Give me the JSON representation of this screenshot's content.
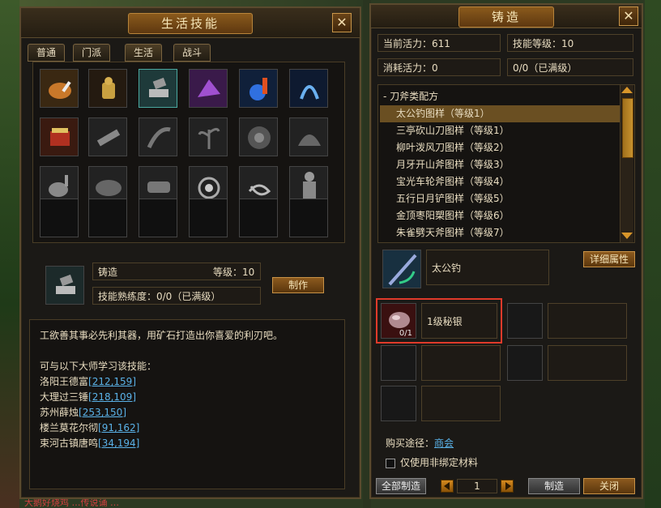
{
  "life_skills": {
    "title": "生活技能",
    "tabs": [
      "普通",
      "门派",
      "生活",
      "战斗"
    ],
    "skill": {
      "name": "铸造",
      "level_label": "等级：10",
      "proficiency": "技能熟练度：0/0（已满级）",
      "make_button": "制作"
    },
    "desc": {
      "intro": "工欲善其事必先利其器，用矿石打造出你喜爱的利刃吧。",
      "masters_header": "可与以下大师学习该技能：",
      "masters": [
        {
          "name": "洛阳王德富",
          "coord": "[212,159]"
        },
        {
          "name": "大理过三锤",
          "coord": "[218,109]"
        },
        {
          "name": "苏州薛烛",
          "coord": "[253,150]"
        },
        {
          "name": "楼兰莫花尔彻",
          "coord": "[91,162]"
        },
        {
          "name": "束河古镇唐鸣",
          "coord": "[34,194]"
        }
      ]
    }
  },
  "forge": {
    "title": "铸造",
    "current_vigor": "当前活力：611",
    "skill_level": "技能等级：10",
    "cost_vigor": "消耗活力：0",
    "progress": "0/0（已满级）",
    "category": "-  刀斧类配方",
    "recipes": [
      "太公钓图样（等级1）",
      "三亭砍山刀图样（等级1）",
      "柳叶泼风刀图样（等级2）",
      "月牙开山斧图样（等级3）",
      "宝光车轮斧图样（等级4）",
      "五行日月铲图样（等级5）",
      "金顶枣阳槊图样（等级6）",
      "朱雀劈天斧图样（等级7）"
    ],
    "selected_index": 0,
    "product_name": "太公钓",
    "detail_button": "详细属性",
    "material": {
      "name": "1级秘银",
      "count": "0/1"
    },
    "purchase_label": "购买途径：",
    "purchase_link": "商会",
    "unbound_label": "仅使用非绑定材料",
    "all_make_button": "全部制造",
    "quantity": "1",
    "make_button": "制造",
    "close_button": "关闭"
  },
  "bg_fragments": {
    "chat_line": "大鹅好烧鸡 …传说诵 …"
  }
}
